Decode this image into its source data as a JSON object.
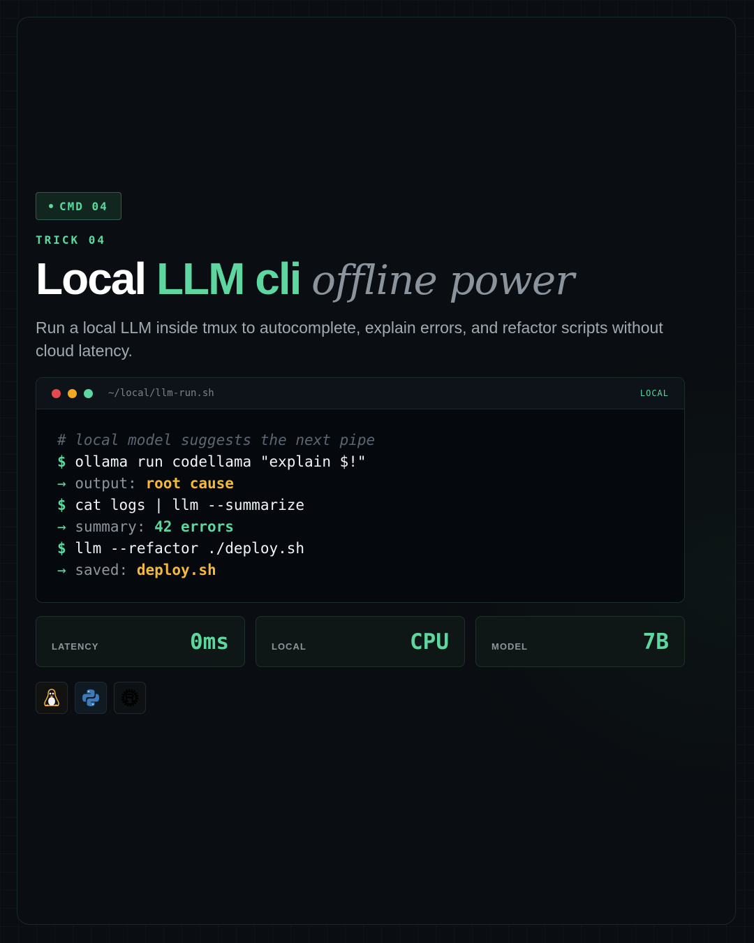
{
  "badge": {
    "label": "CMD 04"
  },
  "eyebrow": "TRICK 04",
  "headline": {
    "part1": "Local",
    "part2": "LLM cli",
    "part3": "offline power"
  },
  "subtitle": "Run a local LLM inside tmux to autocomplete, explain errors, and refactor scripts without cloud latency.",
  "terminal": {
    "path": "~/local/llm-run.sh",
    "tag": "LOCAL",
    "dot_colors": [
      "#e5484d",
      "#f5a524",
      "#5dd6a0"
    ],
    "comment": "# local model suggests the next pipe",
    "lines": [
      {
        "prompt": "$",
        "cmd": "ollama run codellama \"explain $!\""
      },
      {
        "arrow": "→",
        "label": "output:",
        "value": "root cause"
      },
      {
        "prompt": "$",
        "cmd": "cat logs | llm --summarize"
      },
      {
        "arrow": "→",
        "label": "summary:",
        "value": "42 errors"
      },
      {
        "prompt": "$",
        "cmd": "llm --refactor ./deploy.sh"
      },
      {
        "arrow": "→",
        "label": "saved:",
        "value": "deploy.sh"
      }
    ]
  },
  "stats": [
    {
      "label": "LATENCY",
      "value": "0ms"
    },
    {
      "label": "LOCAL",
      "value": "CPU"
    },
    {
      "label": "MODEL",
      "value": "7B"
    }
  ],
  "icons": [
    "linux-tux-icon",
    "python-icon",
    "rust-icon"
  ],
  "colors": {
    "accent": "#5dd6a0",
    "amber": "#f4b83a",
    "background": "#0a0d11"
  }
}
